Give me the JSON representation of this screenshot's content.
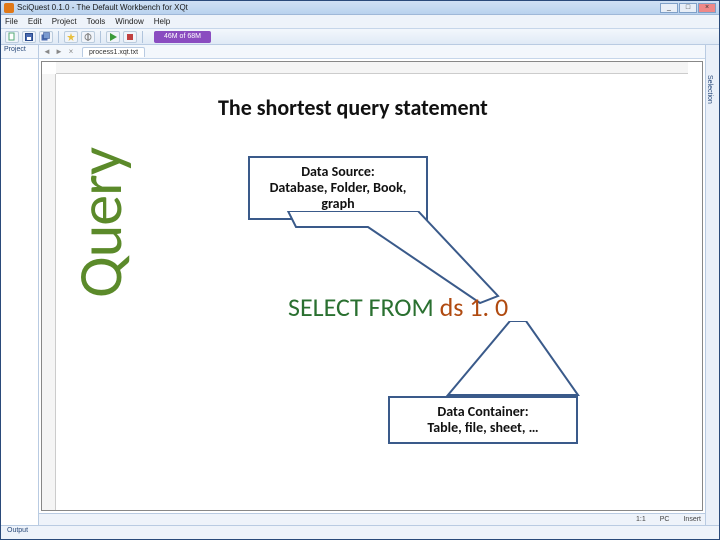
{
  "window": {
    "title": "SciQuest 0.1.0 - The Default Workbench for XQt",
    "buttons": {
      "min": "_",
      "max": "□",
      "close": "×"
    }
  },
  "menubar": [
    "File",
    "Edit",
    "Project",
    "Tools",
    "Window",
    "Help"
  ],
  "toolbar": {
    "memory": "46M of 68M"
  },
  "left_panel": {
    "tab": "Project"
  },
  "nav": {
    "back": "◄",
    "fwd": "►",
    "close": "×",
    "file_tab": "process1.xqt.txt"
  },
  "right_panel": {
    "label": "Selection"
  },
  "statusbar": {
    "left": "",
    "ratio": "1:1",
    "device": "PC",
    "mode": "Insert"
  },
  "bottom_panel": {
    "tab": "Output"
  },
  "slide": {
    "rotated": "Query",
    "title": "The shortest query statement",
    "callout_top_l1": "Data Source:",
    "callout_top_l2": "Database, Folder, Book,",
    "callout_top_l3": "graph",
    "callout_bottom_l1": "Data Container:",
    "callout_bottom_l2": "Table, file, sheet, …",
    "query_kw": "SELECT FROM",
    "query_ds": " ds 1. 0"
  }
}
